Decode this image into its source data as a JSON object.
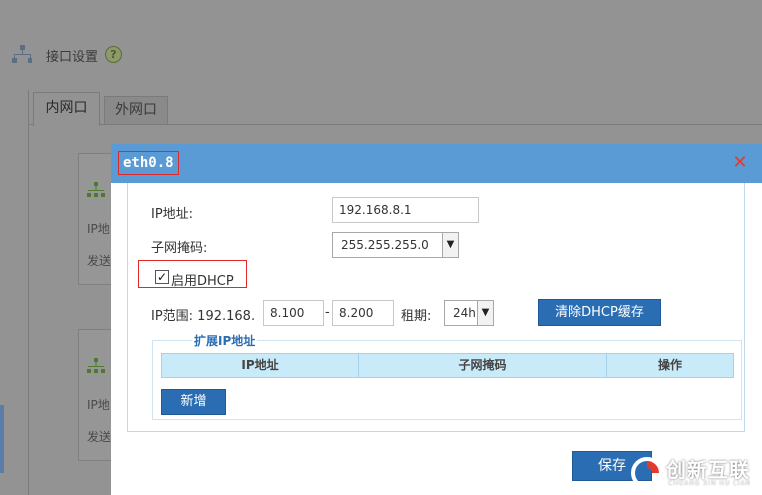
{
  "background": {
    "header_title": "接口设置",
    "help_glyph": "?",
    "tabs": [
      {
        "label": "内网口",
        "active": true
      },
      {
        "label": "外网口",
        "active": false
      }
    ],
    "cards": [
      {
        "line1": "IP地",
        "line2": "发送"
      },
      {
        "line1": "IP地",
        "line2": "发送"
      }
    ]
  },
  "modal": {
    "title": "eth0.8",
    "close_glyph": "✕",
    "ip_label": "IP地址:",
    "ip_value": "192.168.8.1",
    "mask_label": "子网掩码:",
    "mask_value": "255.255.255.0",
    "dhcp_checked": true,
    "dhcp_label": "启用DHCP",
    "range_label": "IP范围: 192.168.",
    "range_start": "8.100",
    "range_sep": "-",
    "range_end": "8.200",
    "lease_label": "租期:",
    "lease_value": "24h",
    "clear_cache_button": "清除DHCP缓存",
    "extend_legend": "扩展IP地址",
    "table_headers": [
      "IP地址",
      "子网掩码",
      "操作"
    ],
    "add_button": "新增",
    "save_button": "保存"
  },
  "watermark": {
    "text": "创新互联",
    "subtext": "CHUANG XIN HU LIAN"
  },
  "colors": {
    "modal_header": "#5b9bd5",
    "primary_button": "#2b6db3",
    "highlight_box": "#e02a2a",
    "table_header": "#c9eaf8"
  }
}
